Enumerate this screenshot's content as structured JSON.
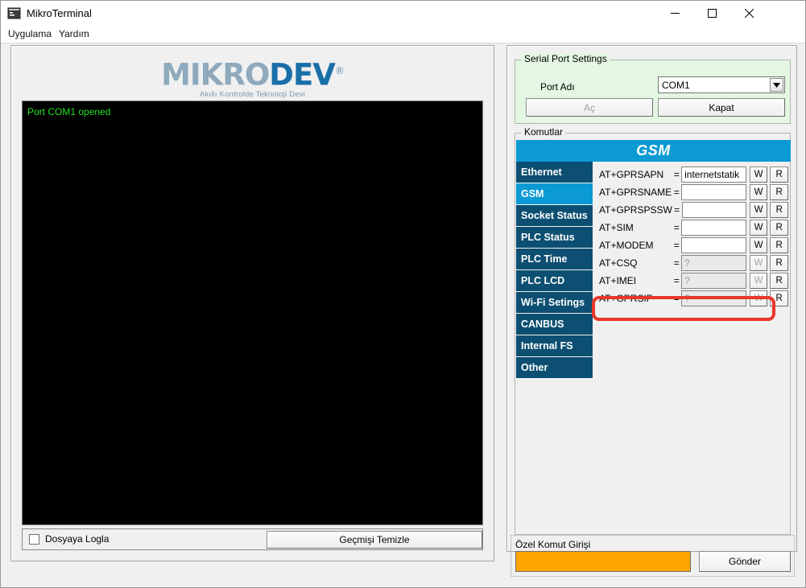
{
  "window": {
    "title": "MikroTerminal",
    "icon": "console-icon",
    "minimize_label": "–",
    "maximize_label": "□",
    "close_label": "✕"
  },
  "menubar": {
    "items": [
      {
        "label": "Uygulama"
      },
      {
        "label": "Yardım"
      }
    ]
  },
  "branding": {
    "logo_part1": "MIKRO",
    "logo_part2": "DEV",
    "registered_mark": "®",
    "tagline": "Akıllı Kontrolde Teknoloji Devi",
    "logo_color_part1": "#8fa9bd",
    "logo_color_part2": "#1a6fa8"
  },
  "terminal": {
    "lines": [
      "Port COM1 opened"
    ],
    "text_color": "#22e022",
    "background_color": "#000000"
  },
  "left_bottom": {
    "log_checkbox_label": "Dosyaya Logla",
    "log_checkbox_checked": false,
    "clear_history_label": "Geçmişi Temizle"
  },
  "serial_port": {
    "legend": "Serial Port Settings",
    "port_label": "Port Adı",
    "port_value": "COM1",
    "port_options": [
      "COM1"
    ],
    "open_label": "Aç",
    "open_disabled": true,
    "close_label": "Kapat",
    "close_disabled": false,
    "panel_color": "#e3f7e3"
  },
  "komutlar": {
    "legend": "Komutlar",
    "section_title": "GSM",
    "header_color": "#0b9ad4",
    "tab_color": "#0d4f72",
    "tabs": [
      {
        "label": "Ethernet",
        "active": false
      },
      {
        "label": "GSM",
        "active": true
      },
      {
        "label": "Socket Status",
        "active": false
      },
      {
        "label": "PLC Status",
        "active": false
      },
      {
        "label": "PLC Time",
        "active": false
      },
      {
        "label": "PLC LCD",
        "active": false
      },
      {
        "label": "Wi-Fi Setings",
        "active": false
      },
      {
        "label": "CANBUS",
        "active": false
      },
      {
        "label": "Internal FS",
        "active": false
      },
      {
        "label": "Other",
        "active": false
      }
    ],
    "equals_sign": "=",
    "write_label": "W",
    "read_label": "R",
    "commands": [
      {
        "name": "AT+GPRSAPN",
        "value": "internetstatik",
        "disabled": false,
        "write_disabled": false,
        "highlighted": false
      },
      {
        "name": "AT+GPRSNAME",
        "value": "",
        "disabled": false,
        "write_disabled": false,
        "highlighted": false
      },
      {
        "name": "AT+GPRSPSSW",
        "value": "",
        "disabled": false,
        "write_disabled": false,
        "highlighted": false
      },
      {
        "name": "AT+SIM",
        "value": "",
        "disabled": false,
        "write_disabled": false,
        "highlighted": false
      },
      {
        "name": "AT+MODEM",
        "value": "",
        "disabled": false,
        "write_disabled": false,
        "highlighted": false
      },
      {
        "name": "AT+CSQ",
        "value": "?",
        "disabled": true,
        "write_disabled": true,
        "highlighted": false
      },
      {
        "name": "AT+IMEI",
        "value": "?",
        "disabled": true,
        "write_disabled": true,
        "highlighted": false
      },
      {
        "name": "AT+GPRSIP",
        "value": "?",
        "disabled": true,
        "write_disabled": true,
        "highlighted": true
      }
    ],
    "highlight_color": "#e8372a"
  },
  "ozel_komut": {
    "label": "Özel Komut Girişi",
    "input_value": "",
    "input_color": "#ffa500",
    "send_label": "Gönder"
  }
}
